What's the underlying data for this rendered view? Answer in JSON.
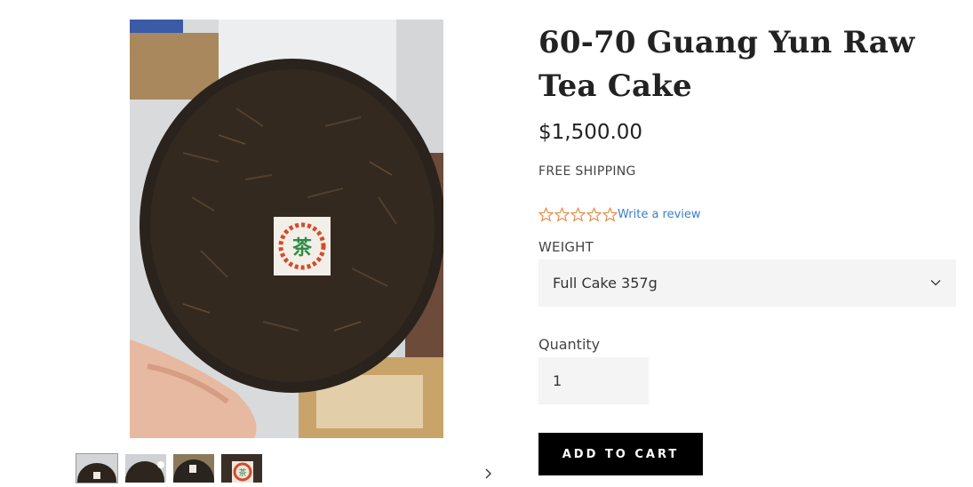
{
  "product": {
    "title": "60-70 Guang Yun Raw Tea Cake",
    "price": "$1,500.00",
    "shipping_note": "FREE SHIPPING"
  },
  "reviews": {
    "rating": 0,
    "max_rating": 5,
    "link_label": "Write a review",
    "star_color": "#e8863a"
  },
  "options": {
    "weight_label": "WEIGHT",
    "weight_selected": "Full Cake 357g"
  },
  "quantity": {
    "label": "Quantity",
    "value": "1"
  },
  "actions": {
    "add_to_cart_label": "ADD TO CART"
  },
  "gallery": {
    "thumbnail_count": 4,
    "active_index": 0,
    "next_icon": "chevron-right-icon"
  },
  "theme": {
    "button_bg": "#000000",
    "field_bg": "#f4f4f4",
    "link_color": "#3a7ec9"
  }
}
